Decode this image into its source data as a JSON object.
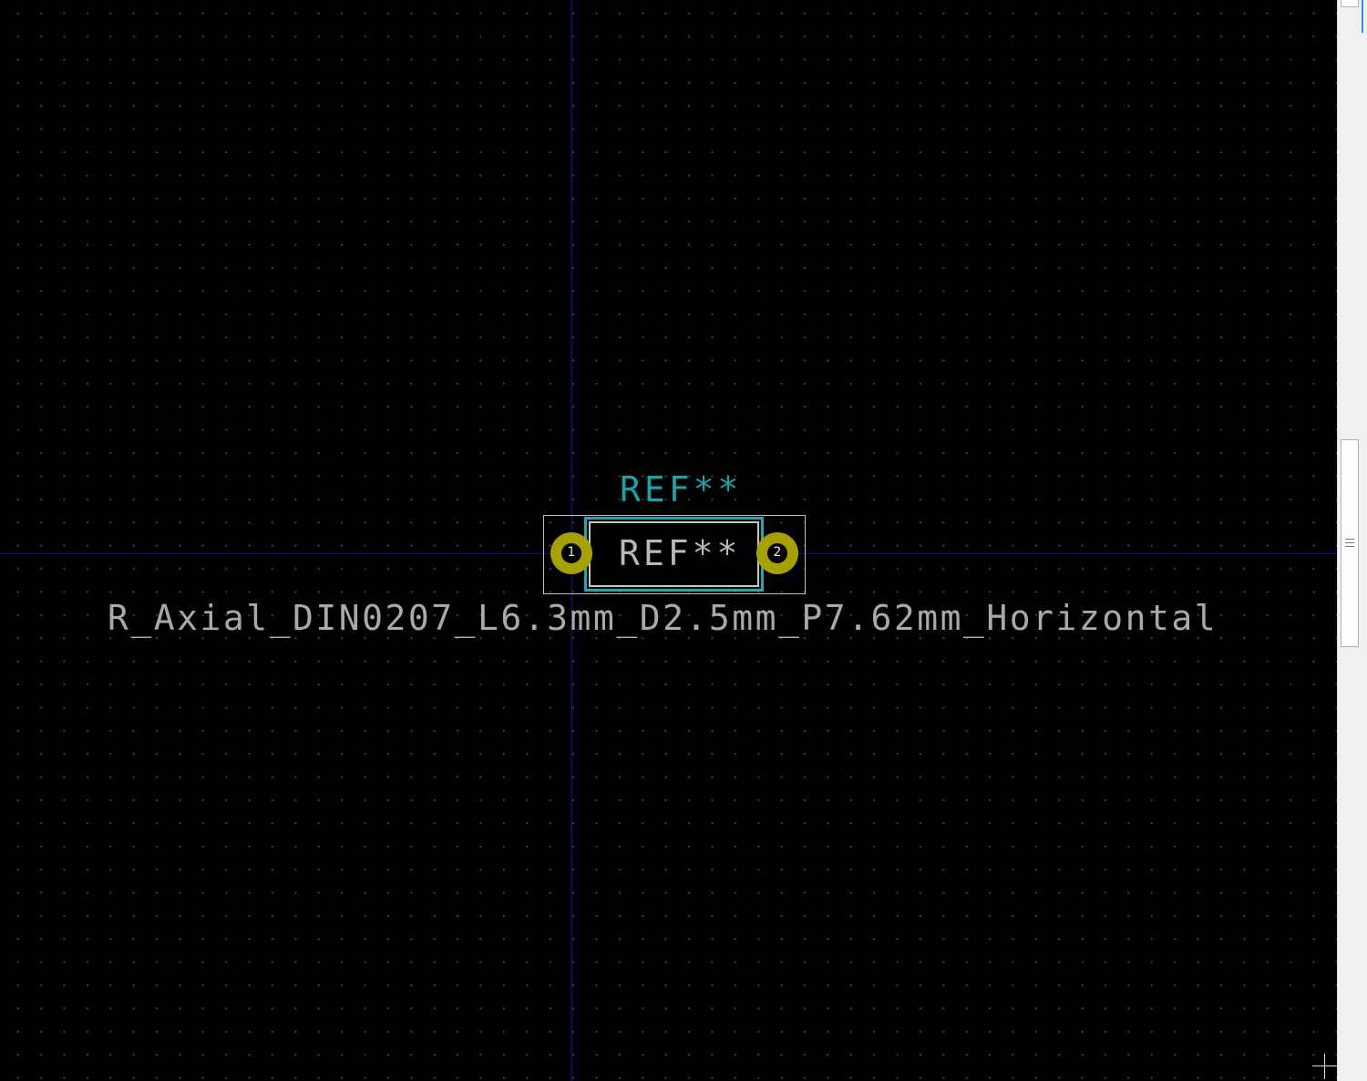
{
  "footprint": {
    "reference_top": "REF**",
    "reference_center": "REF**",
    "value": "R_Axial_DIN0207_L6.3mm_D2.5mm_P7.62mm_Horizontal",
    "pads": [
      {
        "number": "1"
      },
      {
        "number": "2"
      }
    ]
  },
  "colors": {
    "background": "#000000",
    "grid_dot": "#4a4a4a",
    "axis": "#0a0ab0",
    "silkscreen": "#23a8ab",
    "fab": "#c6c6c6",
    "courtyard": "#bfbfbf",
    "pad": "#a6a100",
    "value_text": "#a9a9a9"
  },
  "icons": {
    "scroll_grip": "grip-icon",
    "cursor": "crosshair-cursor-icon"
  }
}
